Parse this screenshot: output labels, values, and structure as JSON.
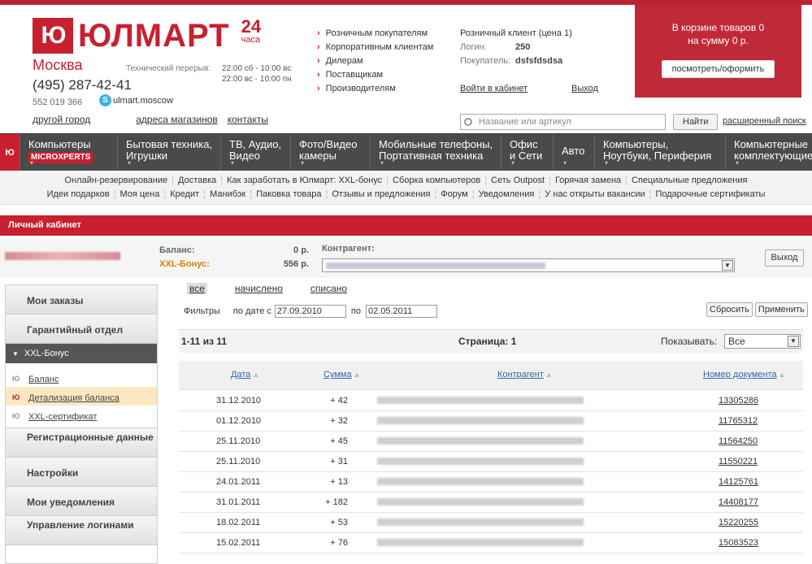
{
  "header": {
    "logo_mark": "Ю",
    "logo_text": "ЮЛМАРТ",
    "logo_24": "24",
    "logo_24_unit": "часа",
    "city": "Москва",
    "phone": "(495) 287-42-41",
    "phone2": "552 019 366",
    "skype": "ulmart.moscow",
    "break_label": "Технический перерыв:",
    "break_times": [
      "22:00 сб - 10:00 вс",
      "22:00 вс - 10:00 пн"
    ],
    "links": [
      "другой город",
      "адреса магазинов",
      "контакты"
    ],
    "roles": [
      "Розничным покупателям",
      "Корпоративным клиентам",
      "Дилерам",
      "Поставщикам",
      "Производителям"
    ],
    "client_title": "Розничный клиент (цена 1)",
    "login_label": "Логин:",
    "login_value": "250",
    "buyer_label": "Покупатель:",
    "buyer_value": "dsfsfdsdsa",
    "cabinet_link": "Войти в кабинет",
    "exit_link": "Выход",
    "search_placeholder": "Название или артикул",
    "search_button": "Найти",
    "advanced_search": "расширенный поиск"
  },
  "cart": {
    "line1": "В корзине товаров 0",
    "line2": "на сумму 0 р.",
    "button": "посмотреть/оформить"
  },
  "menu": {
    "home": "Ю",
    "items": [
      {
        "l1": "Компьютеры",
        "l2": "MICROXPERTS"
      },
      {
        "l1": "Бытовая техника,",
        "l2": "Игрушки"
      },
      {
        "l1": "ТВ, Аудио,",
        "l2": "Видео"
      },
      {
        "l1": "Фото/Видео",
        "l2": "камеры"
      },
      {
        "l1": "Мобильные телефоны,",
        "l2": "Портативная техника"
      },
      {
        "l1": "Офис",
        "l2": "и Сети"
      },
      {
        "l1": "Авто",
        "l2": ""
      },
      {
        "l1": "Компьютеры,",
        "l2": "Ноутбуки, Периферия"
      },
      {
        "l1": "Компьютерные",
        "l2": "комплектующие"
      }
    ]
  },
  "submenu": {
    "row1": [
      "Онлайн-резервирование",
      "Доставка",
      "Как заработать в Юлмарт:",
      "XXL-бонус",
      "Сборка компьютеров",
      "Сеть Outpost",
      "Горячая замена",
      "Специальные предложения"
    ],
    "row2": [
      "Идеи подарков",
      "Моя цена",
      "Кредит",
      "Манибэк",
      "Паковка товара",
      "Отзывы и предложения",
      "Форум",
      "Уведомления",
      "У нас открыты вакансии",
      "Подарочные сертификаты"
    ]
  },
  "account": {
    "bar_title": "Личный кабинет",
    "balance_label": "Баланс:",
    "balance_value": "0 р.",
    "xxl_label": "XXL-Бонус:",
    "xxl_value": "556 р.",
    "contractor_label": "Контрагент:",
    "exit_button": "Выход"
  },
  "sidebar": {
    "items_top": [
      "Мои заказы",
      "Гарантийный отдел"
    ],
    "active": "XXL-Бонус",
    "links": [
      "Баланс",
      "Детализация баланса",
      "XXL-сертификат"
    ],
    "current_link": 1,
    "items_bottom": [
      "Регистрационные данные",
      "Настройки",
      "Мои уведомления",
      "Управление логинами"
    ]
  },
  "tabs": [
    "все",
    "начислено",
    "списано"
  ],
  "filters": {
    "label": "Фильтры",
    "from_label": "по дате с",
    "from": "27.09.2010",
    "to_label": "по",
    "to": "02.05.2011",
    "reset": "Сбросить",
    "apply": "Применить"
  },
  "pager": {
    "count": "1-11 из 11",
    "page": "Страница: 1",
    "show_label": "Показывать:",
    "show_value": "Все"
  },
  "table": {
    "headers": [
      "Дата",
      "Сумма",
      "Контрагент",
      "Номер документа"
    ],
    "rows": [
      {
        "date": "31.12.2010",
        "sum": "+ 42",
        "doc": "13305286"
      },
      {
        "date": "01.12.2010",
        "sum": "+ 32",
        "doc": "11765312"
      },
      {
        "date": "25.11.2010",
        "sum": "+ 45",
        "doc": "11564250"
      },
      {
        "date": "25.11.2010",
        "sum": "+ 31",
        "doc": "11550221"
      },
      {
        "date": "24.01.2011",
        "sum": "+ 13",
        "doc": "14125761"
      },
      {
        "date": "31.01.2011",
        "sum": "+ 182",
        "doc": "14408177"
      },
      {
        "date": "18.02.2011",
        "sum": "+ 53",
        "doc": "15220255"
      },
      {
        "date": "15.02.2011",
        "sum": "+ 76",
        "doc": "15083523"
      }
    ]
  },
  "colors": {
    "brand": "#c8202f",
    "accent_orange": "#e07c00",
    "menu_bg": "#4a4a4a"
  }
}
